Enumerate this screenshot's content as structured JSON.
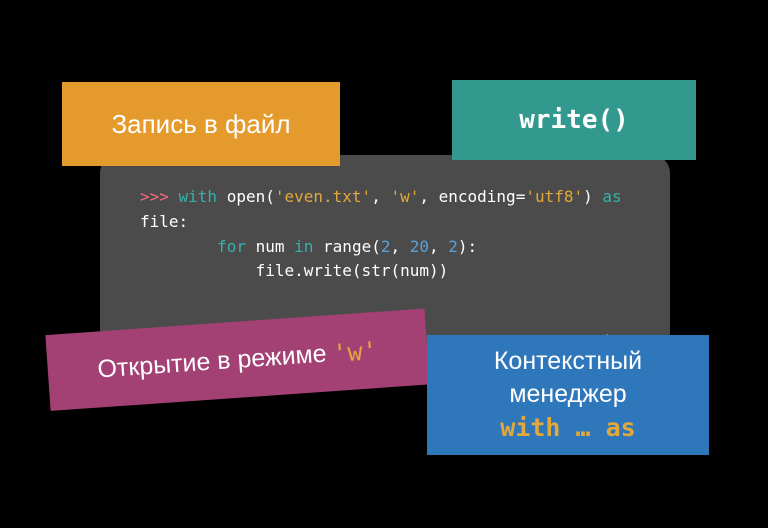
{
  "labels": {
    "orange": "Запись в файл",
    "teal": "write()",
    "purple_text": "Открытие в режиме ",
    "purple_mode": "'w'",
    "blue_line1": "Контекстный",
    "blue_line2": "менеджер",
    "blue_mono": "with … as"
  },
  "code": {
    "prompt": ">>> ",
    "with": "with",
    "open": " open(",
    "file_arg": "'even.txt'",
    "comma1": ", ",
    "mode_arg": "'w'",
    "comma2": ", encoding=",
    "enc_arg": "'utf8'",
    "close_open": ") ",
    "as": "as",
    "file_colon_newline": "\nfile:",
    "indent1": "        ",
    "for": "for",
    "num": " num ",
    "in": "in",
    "range": " range(",
    "r1": "2",
    "rc1": ", ",
    "r2": "20",
    "rc2": ", ",
    "r3": "2",
    "range_close": "):",
    "indent2": "            file.write(str(num))"
  },
  "watermark": "smartiqa.ru"
}
